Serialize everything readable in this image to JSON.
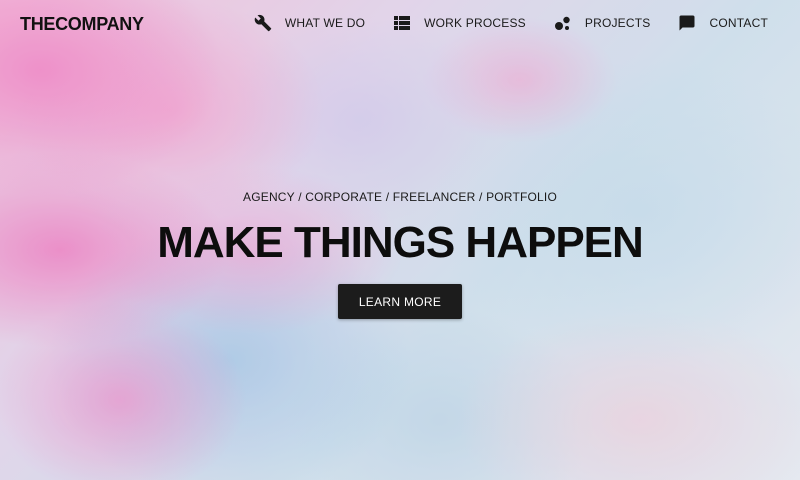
{
  "brand": {
    "name": "THECOMPANY"
  },
  "nav": {
    "items": [
      {
        "label": "WHAT WE DO",
        "icon": "wrench-icon"
      },
      {
        "label": "WORK PROCESS",
        "icon": "list-icon"
      },
      {
        "label": "PROJECTS",
        "icon": "bubbles-icon"
      },
      {
        "label": "CONTACT",
        "icon": "chat-bubble-icon"
      }
    ]
  },
  "hero": {
    "tagline": "AGENCY / CORPORATE / FREELANCER / PORTFOLIO",
    "headline": "MAKE THINGS HAPPEN",
    "cta_label": "LEARN MORE"
  },
  "colors": {
    "text": "#111111",
    "button_bg": "#1c1c1c",
    "button_text": "#ffffff",
    "background_pink": "#ec78be",
    "background_blue": "#c9dbe9"
  }
}
